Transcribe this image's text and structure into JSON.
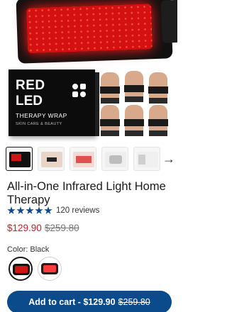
{
  "product": {
    "title": "All-in-One Infrared Light Home Therapy",
    "rating_stars": 5,
    "review_count": "120 reviews",
    "price": "$129.90",
    "compare_at_price": "$259.80"
  },
  "hero": {
    "box_line1": "RED",
    "box_line2": "LED",
    "box_line3": "THERAPY WRAP",
    "box_line4": "SKIN CARE & BEAUTY"
  },
  "gallery": {
    "thumbnails": [
      "thumbnail-1",
      "thumbnail-2",
      "thumbnail-3",
      "thumbnail-4",
      "thumbnail-5"
    ],
    "next_icon": "chevron-right-icon",
    "next_glyph": "→"
  },
  "variant": {
    "color_label": "Color: Black",
    "swatches": [
      "swatch-black",
      "swatch-alt"
    ]
  },
  "cart": {
    "label": "Add to cart - ",
    "price": "$129.90",
    "compare": "$259.80"
  },
  "colors": {
    "accent": "#0b4a8b",
    "sale_price": "#c0202a",
    "led_red": "#d41010"
  }
}
